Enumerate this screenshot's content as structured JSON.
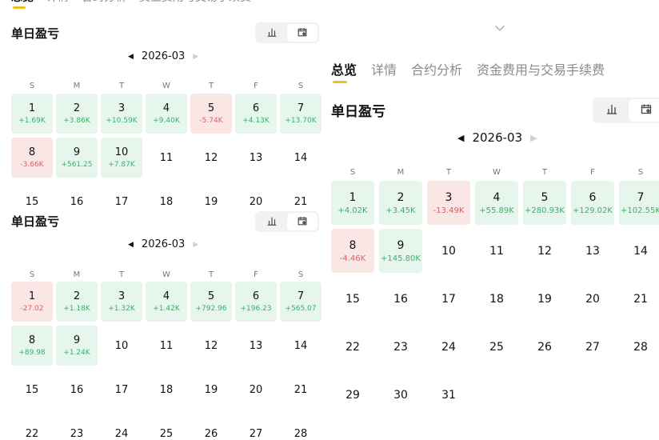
{
  "tabs": [
    "总览",
    "详情",
    "合约分析",
    "资金费用与交易手续费"
  ],
  "section_title": "单日盈亏",
  "weekdays": [
    "S",
    "M",
    "T",
    "W",
    "T",
    "F",
    "S"
  ],
  "icons": {
    "bar_chart": "bar-chart-icon",
    "calendar": "calendar-icon",
    "chevron": "chevron-down-icon"
  },
  "colors": {
    "accent": "#f0c419",
    "profit": "#35b36b",
    "profit_bg": "#e6f6ec",
    "loss": "#e35c5c",
    "loss_bg": "#fbe6e6"
  },
  "panels": [
    {
      "month": "2026-03",
      "days": [
        {
          "day": "1",
          "pnl": "+1.69K"
        },
        {
          "day": "2",
          "pnl": "+3.86K"
        },
        {
          "day": "3",
          "pnl": "+10.59K"
        },
        {
          "day": "4",
          "pnl": "+9.40K"
        },
        {
          "day": "5",
          "pnl": "-5.74K"
        },
        {
          "day": "6",
          "pnl": "+4.13K"
        },
        {
          "day": "7",
          "pnl": "+13.70K"
        },
        {
          "day": "8",
          "pnl": "-3.66K"
        },
        {
          "day": "9",
          "pnl": "+561.25"
        },
        {
          "day": "10",
          "pnl": "+7.87K"
        },
        {
          "day": "11"
        },
        {
          "day": "12"
        },
        {
          "day": "13"
        },
        {
          "day": "14"
        },
        {
          "day": "15"
        },
        {
          "day": "16"
        },
        {
          "day": "17"
        },
        {
          "day": "18"
        },
        {
          "day": "19"
        },
        {
          "day": "20"
        },
        {
          "day": "21"
        }
      ]
    },
    {
      "month": "2026-03",
      "days": [
        {
          "day": "1",
          "pnl": "-27.02"
        },
        {
          "day": "2",
          "pnl": "+1.18K"
        },
        {
          "day": "3",
          "pnl": "+1.32K"
        },
        {
          "day": "4",
          "pnl": "+1.42K"
        },
        {
          "day": "5",
          "pnl": "+792.96"
        },
        {
          "day": "6",
          "pnl": "+196.23"
        },
        {
          "day": "7",
          "pnl": "+565.07"
        },
        {
          "day": "8",
          "pnl": "+89.98"
        },
        {
          "day": "9",
          "pnl": "+1.24K"
        },
        {
          "day": "10"
        },
        {
          "day": "11"
        },
        {
          "day": "12"
        },
        {
          "day": "13"
        },
        {
          "day": "14"
        },
        {
          "day": "15"
        },
        {
          "day": "16"
        },
        {
          "day": "17"
        },
        {
          "day": "18"
        },
        {
          "day": "19"
        },
        {
          "day": "20"
        },
        {
          "day": "21"
        },
        {
          "day": "22"
        },
        {
          "day": "23"
        },
        {
          "day": "24"
        },
        {
          "day": "25"
        },
        {
          "day": "26"
        },
        {
          "day": "27"
        },
        {
          "day": "28"
        }
      ]
    },
    {
      "month": "2026-03",
      "days": [
        {
          "day": "1",
          "pnl": "+4.02K"
        },
        {
          "day": "2",
          "pnl": "+3.45K"
        },
        {
          "day": "3",
          "pnl": "-13.49K"
        },
        {
          "day": "4",
          "pnl": "+55.89K"
        },
        {
          "day": "5",
          "pnl": "+280.93K"
        },
        {
          "day": "6",
          "pnl": "+129.02K"
        },
        {
          "day": "7",
          "pnl": "+102.55K"
        },
        {
          "day": "8",
          "pnl": "-4.46K"
        },
        {
          "day": "9",
          "pnl": "+145.80K"
        },
        {
          "day": "10"
        },
        {
          "day": "11"
        },
        {
          "day": "12"
        },
        {
          "day": "13"
        },
        {
          "day": "14"
        },
        {
          "day": "15"
        },
        {
          "day": "16"
        },
        {
          "day": "17"
        },
        {
          "day": "18"
        },
        {
          "day": "19"
        },
        {
          "day": "20"
        },
        {
          "day": "21"
        },
        {
          "day": "22"
        },
        {
          "day": "23"
        },
        {
          "day": "24"
        },
        {
          "day": "25"
        },
        {
          "day": "26"
        },
        {
          "day": "27"
        },
        {
          "day": "28"
        },
        {
          "day": "29"
        },
        {
          "day": "30"
        },
        {
          "day": "31"
        }
      ]
    }
  ]
}
